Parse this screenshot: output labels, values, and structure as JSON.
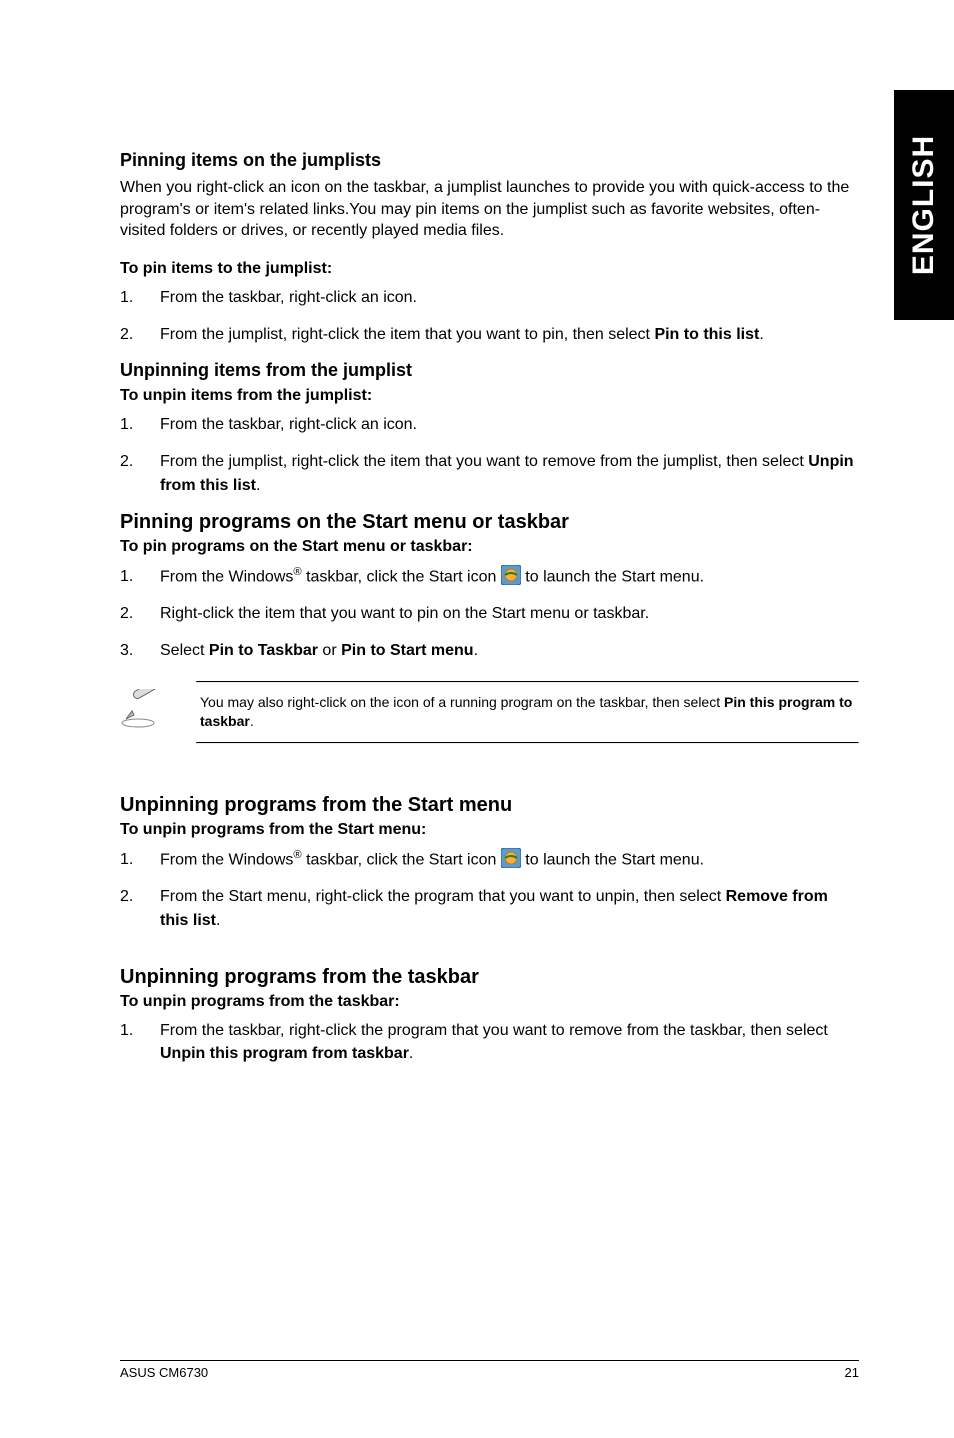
{
  "side_tab": "ENGLISH",
  "section_pin_jumplist": {
    "heading": "Pinning items on the jumplists",
    "intro": "When you right-click an icon on the taskbar, a jumplist launches to provide you with quick-access to the program's or item's related links.You may pin items on the jumplist such as favorite websites, often-visited folders or drives, or recently played media files.",
    "procedure_heading": "To pin items to the jumplist:",
    "steps": [
      {
        "n": "1.",
        "text": "From the taskbar, right-click an icon."
      },
      {
        "n": "2.",
        "text_pre": "From the jumplist, right-click the item that you want to pin, then select ",
        "bold": "Pin to this list",
        "text_post": "."
      }
    ]
  },
  "section_unpin_jumplist": {
    "heading": "Unpinning items from the jumplist",
    "procedure_heading": "To unpin items from the jumplist:",
    "steps": [
      {
        "n": "1.",
        "text": "From the taskbar, right-click an icon."
      },
      {
        "n": "2.",
        "text_pre": "From the jumplist, right-click the item that you want to remove from the jumplist, then select ",
        "bold": "Unpin from this list",
        "text_post": "."
      }
    ]
  },
  "section_pin_programs": {
    "heading": "Pinning programs on the Start menu or taskbar",
    "procedure_heading": "To pin programs on the Start menu or taskbar:",
    "steps": [
      {
        "n": "1.",
        "text_pre": "From the Windows",
        "sup": "®",
        "text_mid": " taskbar, click the Start icon ",
        "has_icon": true,
        "text_post": " to launch the Start menu."
      },
      {
        "n": "2.",
        "text": "Right-click the item that you want to pin on the Start menu or taskbar."
      },
      {
        "n": "3.",
        "text_pre": "Select ",
        "bold": "Pin to Taskbar",
        "text_mid2": " or ",
        "bold2": "Pin to Start menu",
        "text_post": "."
      }
    ],
    "note_pre": "You may also right-click on the icon of a running program on the taskbar, then select ",
    "note_bold": "Pin this program to taskbar",
    "note_post": "."
  },
  "section_unpin_startmenu": {
    "heading": "Unpinning programs from the Start menu",
    "procedure_heading": "To unpin programs from the Start menu:",
    "steps": [
      {
        "n": "1.",
        "text_pre": "From the Windows",
        "sup": "®",
        "text_mid": " taskbar, click the Start icon ",
        "has_icon": true,
        "text_post": " to launch the Start menu."
      },
      {
        "n": "2.",
        "text_pre": "From the Start menu, right-click the program that you want to unpin, then select ",
        "bold": "Remove from this list",
        "text_post": "."
      }
    ]
  },
  "section_unpin_taskbar": {
    "heading": "Unpinning programs from the taskbar",
    "procedure_heading": "To unpin programs from the taskbar:",
    "steps": [
      {
        "n": "1.",
        "text_pre": "From the taskbar, right-click the program that you want to remove from the taskbar, then select ",
        "bold": "Unpin this program from taskbar",
        "text_post": "."
      }
    ]
  },
  "footer": {
    "left": "ASUS CM6730",
    "right": "21"
  }
}
